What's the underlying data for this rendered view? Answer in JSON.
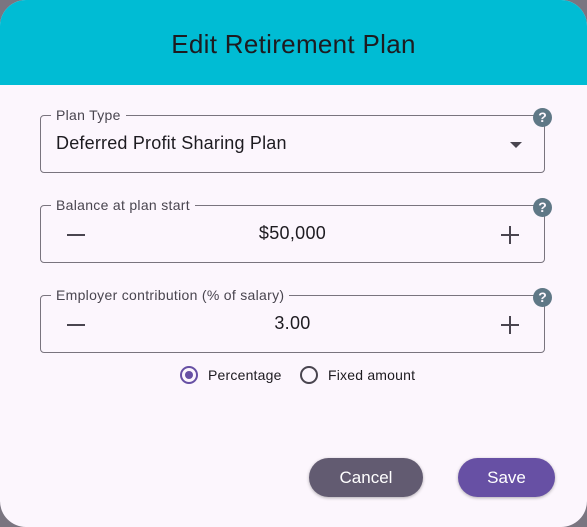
{
  "dialog": {
    "title": "Edit Retirement Plan"
  },
  "plan_type": {
    "label": "Plan Type",
    "value": "Deferred Profit Sharing Plan",
    "help_icon": "help-icon",
    "help_glyph": "?"
  },
  "balance": {
    "label": "Balance at plan start",
    "value": "$50,000",
    "help_glyph": "?"
  },
  "contribution": {
    "label": "Employer contribution (% of salary)",
    "value": "3.00",
    "help_glyph": "?"
  },
  "contribution_mode": {
    "options": [
      {
        "label": "Percentage",
        "selected": true
      },
      {
        "label": "Fixed amount",
        "selected": false
      }
    ]
  },
  "actions": {
    "cancel_label": "Cancel",
    "save_label": "Save"
  },
  "colors": {
    "header": "#00bcd4",
    "primary": "#6750a4",
    "secondary": "#625b71",
    "help_icon": "#5f7886",
    "surface": "#fcf6fd"
  }
}
